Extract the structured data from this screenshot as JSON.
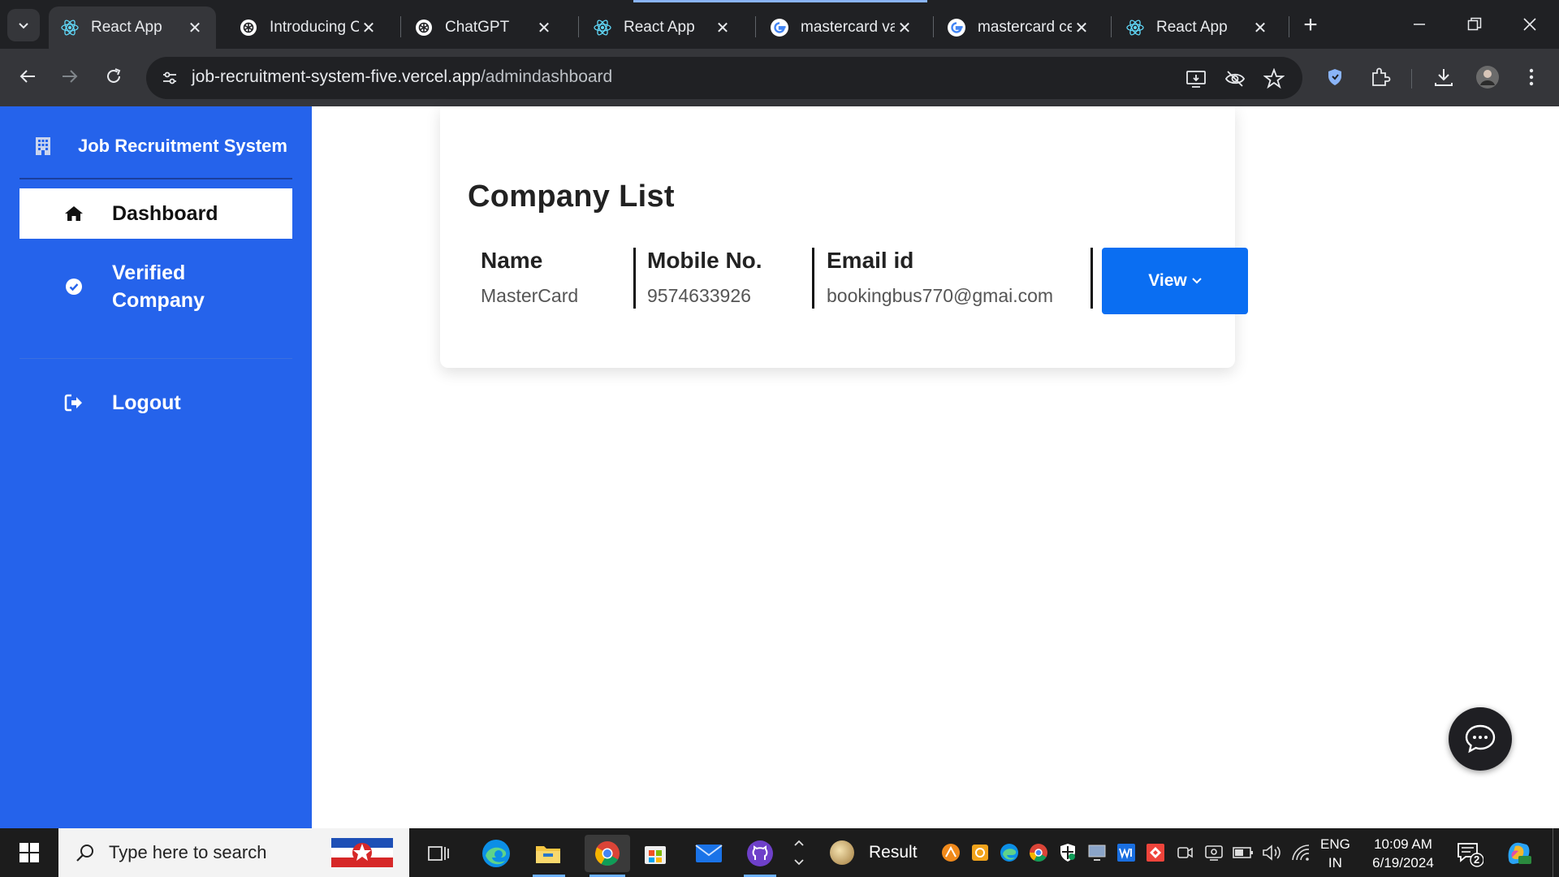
{
  "browser": {
    "tabs": [
      {
        "title": "React App",
        "icon": "react-icon",
        "active": true
      },
      {
        "title": "Introducing Cl",
        "icon": "openai-icon",
        "active": false
      },
      {
        "title": "ChatGPT",
        "icon": "openai-icon",
        "active": false
      },
      {
        "title": "React App",
        "icon": "react-icon",
        "active": false
      },
      {
        "title": "mastercard va",
        "icon": "google-icon",
        "active": false
      },
      {
        "title": "mastercard ce",
        "icon": "google-icon",
        "active": false
      },
      {
        "title": "React App",
        "icon": "react-icon",
        "active": false
      }
    ],
    "url_host": "job-recruitment-system-five.vercel.app",
    "url_path": "/admindashboard"
  },
  "sidebar": {
    "brand": "Job Recruitment System",
    "items": [
      {
        "label": "Dashboard",
        "icon": "home-icon",
        "active": true
      },
      {
        "label": "Verified Company",
        "icon": "check-circle-icon",
        "active": false
      },
      {
        "label": "Logout",
        "icon": "logout-icon",
        "active": false
      }
    ]
  },
  "main": {
    "title": "Company List",
    "columns": {
      "name": "Name",
      "mobile": "Mobile No.",
      "email": "Email id"
    },
    "rows": [
      {
        "name": "MasterCard",
        "mobile": "9574633926",
        "email": "bookingbus770@gmai.com"
      }
    ],
    "view_button": "View"
  },
  "taskbar": {
    "search_placeholder": "Type here to search",
    "result_label": "Result",
    "lang_line1": "ENG",
    "lang_line2": "IN",
    "time": "10:09 AM",
    "date": "6/19/2024",
    "notification_count": "2"
  },
  "colors": {
    "sidebar": "#2563eb",
    "view_button": "#0a6ef2",
    "chrome_dark": "#202124"
  }
}
